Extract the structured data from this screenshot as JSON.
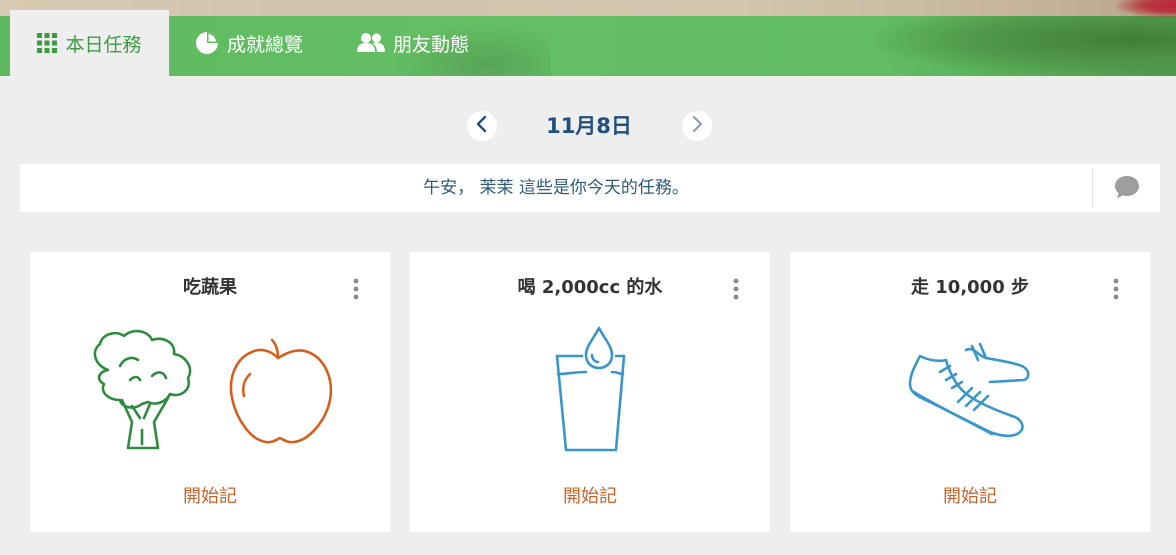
{
  "tabs": [
    {
      "label": "本日任務",
      "icon": "grid-icon",
      "active": true
    },
    {
      "label": "成就總覽",
      "icon": "pie-chart-icon",
      "active": false
    },
    {
      "label": "朋友動態",
      "icon": "friends-icon",
      "active": false
    }
  ],
  "date_nav": {
    "date": "11月8日",
    "prev_icon": "chevron-left-icon",
    "next_icon": "chevron-right-icon"
  },
  "greeting": {
    "text": "午安， 茉茉 這些是你今天的任務。",
    "chat_icon": "chat-bubble-icon"
  },
  "cards": [
    {
      "title": "吃蔬果",
      "action": "開始記",
      "illustration": "broccoli-apple-icon"
    },
    {
      "title": "喝 2,000cc 的水",
      "action": "開始記",
      "illustration": "water-glass-icon"
    },
    {
      "title": "走 10,000 步",
      "action": "開始記",
      "illustration": "sneaker-icon"
    }
  ],
  "colors": {
    "header_green": "#62bd62",
    "active_tab_text": "#3f9b42",
    "date_text": "#1f4f7a",
    "greeting_text": "#2f5a7a",
    "action_orange": "#c8642a",
    "broccoli_green": "#2e8a3e",
    "apple_orange": "#d4601f",
    "water_blue": "#3a96c9",
    "page_bg": "#eeeeee"
  }
}
